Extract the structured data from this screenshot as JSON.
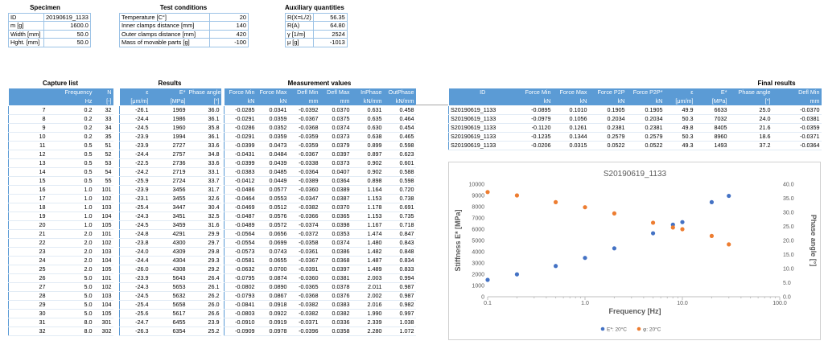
{
  "specimen": {
    "title": "Specimen",
    "rows": [
      {
        "label": "ID",
        "value": "20190619_1133"
      },
      {
        "label": "m [g]",
        "value": "1600.0"
      },
      {
        "label": "Width [mm]",
        "value": "50.0"
      },
      {
        "label": "Hght. [mm]",
        "value": "50.0"
      }
    ]
  },
  "test_conditions": {
    "title": "Test conditions",
    "rows": [
      {
        "label": "Temperature [C°]",
        "value": "20"
      },
      {
        "label": "Inner clamps distance [mm]",
        "value": "140"
      },
      {
        "label": "Outer clamps distance [mm]",
        "value": "420"
      },
      {
        "label": "Mass of movable parts [g]",
        "value": "-100"
      }
    ]
  },
  "auxiliary": {
    "title": "Auxiliary quantities",
    "rows": [
      {
        "label": "R(X=L/2)",
        "value": "56.35"
      },
      {
        "label": "R(A)",
        "value": "64.80"
      },
      {
        "label": "γ [1/m]",
        "value": "2524"
      },
      {
        "label": "μ [g]",
        "value": "-1013"
      }
    ]
  },
  "capture": {
    "title": "Capture list",
    "headers": [
      "",
      "Frequency",
      "N"
    ],
    "units": [
      "",
      "Hz",
      "[-]"
    ],
    "rows": [
      [
        "7",
        "0.2",
        "32"
      ],
      [
        "8",
        "0.2",
        "33"
      ],
      [
        "9",
        "0.2",
        "34"
      ],
      [
        "10",
        "0.2",
        "35"
      ],
      [
        "11",
        "0.5",
        "51"
      ],
      [
        "12",
        "0.5",
        "52"
      ],
      [
        "13",
        "0.5",
        "53"
      ],
      [
        "14",
        "0.5",
        "54"
      ],
      [
        "15",
        "0.5",
        "55"
      ],
      [
        "16",
        "1.0",
        "101"
      ],
      [
        "17",
        "1.0",
        "102"
      ],
      [
        "18",
        "1.0",
        "103"
      ],
      [
        "19",
        "1.0",
        "104"
      ],
      [
        "20",
        "1.0",
        "105"
      ],
      [
        "21",
        "2.0",
        "101"
      ],
      [
        "22",
        "2.0",
        "102"
      ],
      [
        "23",
        "2.0",
        "103"
      ],
      [
        "24",
        "2.0",
        "104"
      ],
      [
        "25",
        "2.0",
        "105"
      ],
      [
        "26",
        "5.0",
        "101"
      ],
      [
        "27",
        "5.0",
        "102"
      ],
      [
        "28",
        "5.0",
        "103"
      ],
      [
        "29",
        "5.0",
        "104"
      ],
      [
        "30",
        "5.0",
        "105"
      ],
      [
        "31",
        "8.0",
        "301"
      ],
      [
        "32",
        "8.0",
        "302"
      ]
    ]
  },
  "results": {
    "title": "Results",
    "headers": [
      "ε",
      "E*",
      "Phase angle"
    ],
    "units": [
      "[μm/m]",
      "[MPa]",
      "[°]"
    ],
    "rows": [
      [
        "-26.1",
        "1969",
        "36.0"
      ],
      [
        "-24.4",
        "1986",
        "36.1"
      ],
      [
        "-24.5",
        "1960",
        "35.8"
      ],
      [
        "-23.9",
        "1994",
        "36.1"
      ],
      [
        "-23.9",
        "2727",
        "33.6"
      ],
      [
        "-24.4",
        "2757",
        "34.8"
      ],
      [
        "-22.5",
        "2736",
        "33.6"
      ],
      [
        "-24.2",
        "2719",
        "33.1"
      ],
      [
        "-25.9",
        "2724",
        "33.7"
      ],
      [
        "-23.9",
        "3456",
        "31.7"
      ],
      [
        "-23.1",
        "3455",
        "32.6"
      ],
      [
        "-25.4",
        "3447",
        "30.4"
      ],
      [
        "-24.3",
        "3451",
        "32.5"
      ],
      [
        "-24.5",
        "3459",
        "31.6"
      ],
      [
        "-24.8",
        "4291",
        "29.9"
      ],
      [
        "-23.8",
        "4300",
        "29.7"
      ],
      [
        "-24.0",
        "4309",
        "29.8"
      ],
      [
        "-24.4",
        "4304",
        "29.3"
      ],
      [
        "-26.0",
        "4308",
        "29.2"
      ],
      [
        "-23.9",
        "5643",
        "26.4"
      ],
      [
        "-24.3",
        "5653",
        "26.1"
      ],
      [
        "-24.5",
        "5632",
        "26.2"
      ],
      [
        "-25.4",
        "5658",
        "26.0"
      ],
      [
        "-25.6",
        "5617",
        "26.6"
      ],
      [
        "-24.7",
        "6455",
        "23.9"
      ],
      [
        "-26.3",
        "6354",
        "25.2"
      ]
    ]
  },
  "measurement": {
    "title": "Measurement values",
    "headers": [
      "Force Min",
      "Force Max",
      "Defl Min",
      "Defl Max",
      "InPhase",
      "OutPhase"
    ],
    "units": [
      "kN",
      "kN",
      "mm",
      "mm",
      "kN/mm",
      "kN/mm"
    ],
    "rows": [
      [
        "-0.0285",
        "0.0341",
        "-0.0392",
        "0.0370",
        "0.631",
        "0.458"
      ],
      [
        "-0.0291",
        "0.0359",
        "-0.0367",
        "0.0375",
        "0.635",
        "0.464"
      ],
      [
        "-0.0286",
        "0.0352",
        "-0.0368",
        "0.0374",
        "0.630",
        "0.454"
      ],
      [
        "-0.0291",
        "0.0359",
        "-0.0359",
        "0.0373",
        "0.638",
        "0.465"
      ],
      [
        "-0.0399",
        "0.0473",
        "-0.0359",
        "0.0379",
        "0.899",
        "0.598"
      ],
      [
        "-0.0431",
        "0.0484",
        "-0.0367",
        "0.0397",
        "0.897",
        "0.623"
      ],
      [
        "-0.0399",
        "0.0439",
        "-0.0338",
        "0.0373",
        "0.902",
        "0.601"
      ],
      [
        "-0.0383",
        "0.0485",
        "-0.0364",
        "0.0407",
        "0.902",
        "0.588"
      ],
      [
        "-0.0412",
        "0.0449",
        "-0.0389",
        "0.0364",
        "0.898",
        "0.598"
      ],
      [
        "-0.0486",
        "0.0577",
        "-0.0360",
        "0.0389",
        "1.164",
        "0.720"
      ],
      [
        "-0.0464",
        "0.0553",
        "-0.0347",
        "0.0387",
        "1.153",
        "0.738"
      ],
      [
        "-0.0469",
        "0.0512",
        "-0.0382",
        "0.0370",
        "1.178",
        "0.691"
      ],
      [
        "-0.0487",
        "0.0576",
        "-0.0366",
        "0.0365",
        "1.153",
        "0.735"
      ],
      [
        "-0.0489",
        "0.0572",
        "-0.0374",
        "0.0398",
        "1.167",
        "0.718"
      ],
      [
        "-0.0564",
        "0.0656",
        "-0.0372",
        "0.0353",
        "1.474",
        "0.847"
      ],
      [
        "-0.0554",
        "0.0699",
        "-0.0358",
        "0.0374",
        "1.480",
        "0.843"
      ],
      [
        "-0.0573",
        "0.0743",
        "-0.0361",
        "0.0386",
        "1.482",
        "0.848"
      ],
      [
        "-0.0581",
        "0.0655",
        "-0.0367",
        "0.0368",
        "1.487",
        "0.834"
      ],
      [
        "-0.0632",
        "0.0700",
        "-0.0391",
        "0.0397",
        "1.489",
        "0.833"
      ],
      [
        "-0.0795",
        "0.0874",
        "-0.0360",
        "0.0381",
        "2.003",
        "0.994"
      ],
      [
        "-0.0802",
        "0.0890",
        "-0.0365",
        "0.0378",
        "2.011",
        "0.987"
      ],
      [
        "-0.0793",
        "0.0867",
        "-0.0368",
        "0.0376",
        "2.002",
        "0.987"
      ],
      [
        "-0.0841",
        "0.0918",
        "-0.0382",
        "0.0383",
        "2.016",
        "0.982"
      ],
      [
        "-0.0803",
        "0.0922",
        "-0.0382",
        "0.0382",
        "1.990",
        "0.997"
      ],
      [
        "-0.0910",
        "0.0919",
        "-0.0371",
        "0.0336",
        "2.339",
        "1.038"
      ],
      [
        "-0.0909",
        "0.0978",
        "-0.0396",
        "0.0358",
        "2.280",
        "1.072"
      ]
    ]
  },
  "final": {
    "title": "Final results",
    "headers": [
      "ID",
      "Force Min",
      "Force Max",
      "Force P2P",
      "Force P2P*",
      "ε",
      "E*",
      "Phase angle",
      "Defl Min"
    ],
    "units": [
      "",
      "kN",
      "kN",
      "kN",
      "kN",
      "[μm/m]",
      "[MPa]",
      "[°]",
      "mm"
    ],
    "rows": [
      [
        "S20190619_1133",
        "-0.0895",
        "0.1010",
        "0.1905",
        "0.1905",
        "49.9",
        "6633",
        "25.0",
        "-0.0370"
      ],
      [
        "S20190619_1133",
        "-0.0979",
        "0.1056",
        "0.2034",
        "0.2034",
        "50.3",
        "7032",
        "24.0",
        "-0.0381"
      ],
      [
        "S20190619_1133",
        "-0.1120",
        "0.1261",
        "0.2381",
        "0.2381",
        "49.8",
        "8405",
        "21.6",
        "-0.0359"
      ],
      [
        "S20190619_1133",
        "-0.1235",
        "0.1344",
        "0.2579",
        "0.2579",
        "50.3",
        "8960",
        "18.6",
        "-0.0371"
      ],
      [
        "S20190619_1133",
        "-0.0206",
        "0.0315",
        "0.0522",
        "0.0522",
        "49.3",
        "1493",
        "37.2",
        "-0.0364"
      ]
    ]
  },
  "chart_data": {
    "type": "scatter",
    "title": "S20190619_1133",
    "xlabel": "Frequency [Hz]",
    "ylabel": "Stiffness E* [MPa]",
    "y2label": "Phase angle [°]",
    "xscale": "log",
    "xlim": [
      0.1,
      100
    ],
    "xticks": [
      "0.1",
      "1.0",
      "10.0",
      "100.0"
    ],
    "ylim": [
      0,
      10000
    ],
    "yticks": [
      "0",
      "1000",
      "2000",
      "3000",
      "4000",
      "5000",
      "6000",
      "7000",
      "8000",
      "9000",
      "10000"
    ],
    "y2lim": [
      0,
      40
    ],
    "y2ticks": [
      "0.0",
      "5.0",
      "10.0",
      "15.0",
      "20.0",
      "25.0",
      "30.0",
      "35.0",
      "40.0"
    ],
    "grid": false,
    "legend_position": "bottom",
    "series": [
      {
        "name": "E*: 20°C",
        "axis": "left",
        "color": "#4472c4",
        "x": [
          0.1,
          0.2,
          0.5,
          1.0,
          2.0,
          5.0,
          8.0,
          10.0,
          20.0,
          30.0
        ],
        "y": [
          1500,
          1990,
          2730,
          3450,
          4300,
          5640,
          6400,
          6630,
          8400,
          8960
        ]
      },
      {
        "name": "φ: 20°C",
        "axis": "right",
        "color": "#ed7d31",
        "x": [
          0.1,
          0.2,
          0.5,
          1.0,
          2.0,
          5.0,
          8.0,
          10.0,
          20.0,
          30.0
        ],
        "y": [
          37.2,
          36.0,
          33.6,
          31.8,
          29.6,
          26.3,
          24.6,
          24.0,
          21.6,
          18.6
        ]
      }
    ]
  }
}
